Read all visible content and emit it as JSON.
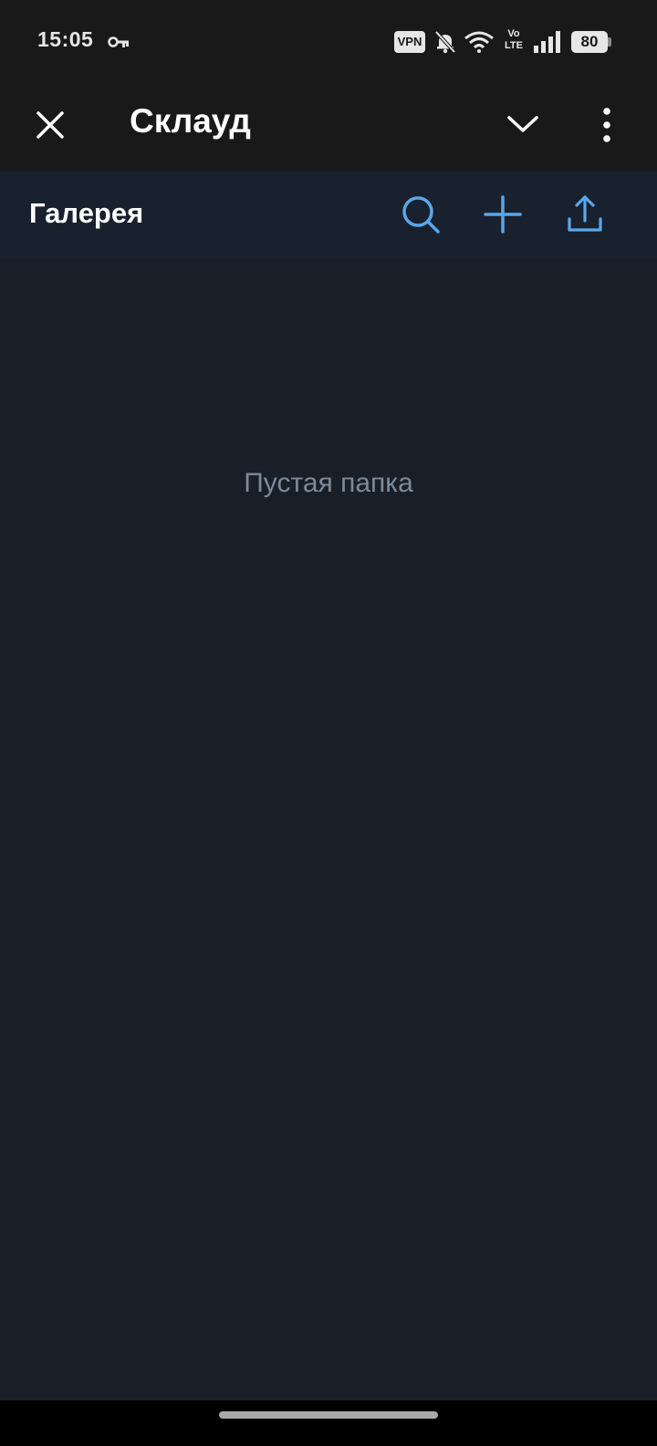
{
  "status_bar": {
    "time": "15:05",
    "icons": [
      "key-icon",
      "vpn-badge",
      "bell-off-icon",
      "wifi-icon",
      "volte-icon",
      "signal-icon",
      "battery-icon"
    ],
    "vpn_label": "VPN",
    "volte_top": "Vo",
    "volte_bottom": "LTE",
    "battery_level": "80"
  },
  "app_bar": {
    "title": "Склауд",
    "close_icon": "close-icon",
    "chevron_icon": "chevron-down-icon",
    "more_icon": "more-vertical-icon"
  },
  "folder_header": {
    "title": "Галерея",
    "actions": [
      "search-icon",
      "plus-icon",
      "upload-icon"
    ]
  },
  "main": {
    "empty_message": "Пустая папка"
  },
  "colors": {
    "background": "#181f29",
    "header_background": "#18212d",
    "app_bar_background": "#191919",
    "accent": "#5aa7e9",
    "empty_text": "#7d8a99"
  }
}
